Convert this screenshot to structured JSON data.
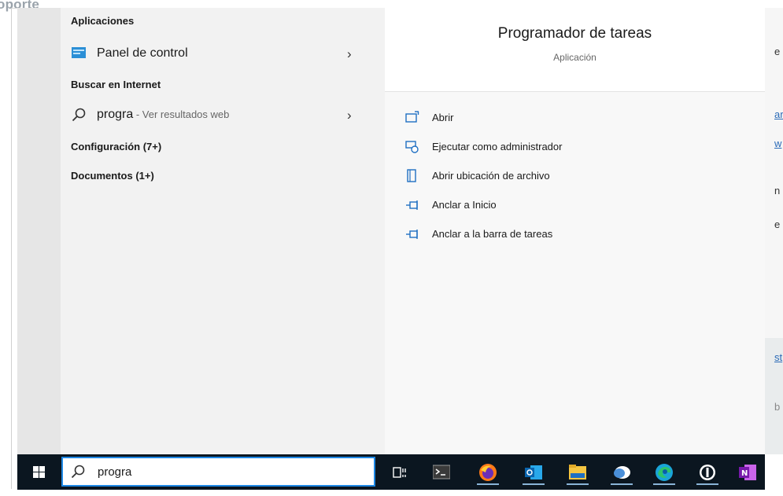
{
  "background": {
    "top_left_label": "oporte"
  },
  "start_left": {
    "sections": {
      "apps_header": "Aplicaciones",
      "web_header": "Buscar en Internet",
      "settings_header": "Configuración (7+)",
      "documents_header": "Documentos (1+)"
    },
    "apps": [
      {
        "label": "Panel de control",
        "icon": "control-panel-icon"
      }
    ],
    "web": {
      "query": "progra",
      "suffix": " - Ver resultados web",
      "icon": "search-icon"
    }
  },
  "detail": {
    "title": "Programador de tareas",
    "subtitle": "Aplicación",
    "actions": [
      {
        "label": "Abrir",
        "icon": "open-icon"
      },
      {
        "label": "Ejecutar como administrador",
        "icon": "run-as-admin-icon"
      },
      {
        "label": "Abrir ubicación de archivo",
        "icon": "file-location-icon"
      },
      {
        "label": "Anclar a Inicio",
        "icon": "pin-icon"
      },
      {
        "label": "Anclar a la barra de tareas",
        "icon": "pin-icon"
      }
    ]
  },
  "taskbar": {
    "search_value": "progra",
    "pinned": [
      "task-view-icon",
      "terminal-icon",
      "firefox-icon",
      "outlook-icon",
      "file-explorer-icon",
      "chat-icon",
      "edge-icon",
      "password-manager-icon",
      "onenote-icon"
    ]
  },
  "colors": {
    "accent": "#1e88e5",
    "taskbar": "#0b1620",
    "action_icon": "#1f6fc2"
  }
}
